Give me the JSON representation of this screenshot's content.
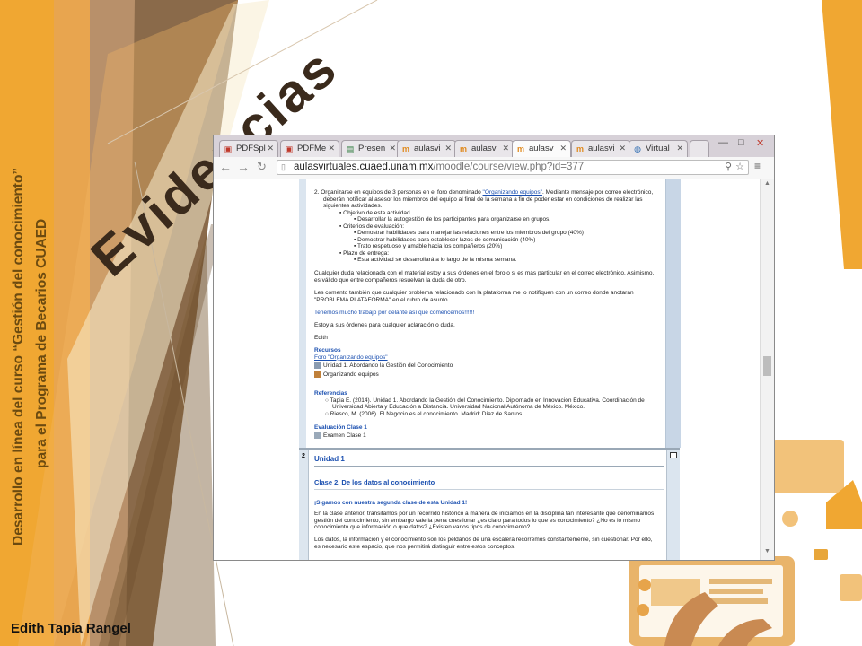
{
  "slide": {
    "title": "Evidencias",
    "vertical_line1": "Desarrollo en línea del curso “Gestión del conocimiento”",
    "vertical_line2": "para el Programa de Becarios CUAED",
    "author": "Edith Tapia Rangel"
  },
  "browser": {
    "tabs": [
      {
        "label": "PDFSpl",
        "active": false
      },
      {
        "label": "PDFMe",
        "active": false
      },
      {
        "label": "Presen",
        "active": false
      },
      {
        "label": "aulasvi",
        "active": false
      },
      {
        "label": "aulasvi",
        "active": false
      },
      {
        "label": "aulasv",
        "active": true
      },
      {
        "label": "aulasvi",
        "active": false
      },
      {
        "label": "Virtual",
        "active": false
      }
    ],
    "url_host": "aulasvirtuales.cuaed.unam.mx",
    "url_path": "/moodle/course/view.php?id=377"
  },
  "content": {
    "item2_a": "2.   Organizarse en equipos de 3 personas en el foro denominado ",
    "item2_link": "\"Organizando equipos\"",
    "item2_b": ". Mediante mensaje por correo electrónico,",
    "item2_c": "deberán notificar al asesor los miembros del equipo al final de la semana a fin de poder estar en condiciones de realizar las",
    "item2_d": "siguientes actividades.",
    "obj_head": "Objetivo de esta actividad",
    "obj_1": "Desarrollar la autogestión de los participantes para organizarse en grupos.",
    "crit_head": "Criterios de evaluación:",
    "crit_1": "Demostrar habilidades para manejar las relaciones entre los miembros del grupo (40%)",
    "crit_2": "Demostrar habilidades para establecer lazos de comunicación (40%)",
    "crit_3": "Trato respetuoso y amable hacia los compañeros (20%)",
    "plazo_head": "Plazo de entrega:",
    "plazo_1": "Esta actividad se desarrollará a lo largo de la misma semana.",
    "p1a": "Cualquier duda relacionada con el material estoy a sus órdenes en el foro o si es más particular en el correo electrónico. Asimismo,",
    "p1b": "es válido que entre compañeros resuelvan la duda de otro.",
    "p2a": "Les comento también que cualquier problema relacionado con la plataforma me lo notifiquen con un correo donde anotarán",
    "p2b": "\"PROBLEMA PLATAFORMA\" en el rubro de asunto.",
    "p3": "Tenemos mucho trabajo por delante así que comencemos!!!!!!",
    "p4": "Estoy a sus órdenes para cualquier aclaración o duda.",
    "p5": "Edith",
    "recursos_head": "Recursos",
    "recursos_link": "Foro \"Organizando equipos\"",
    "recurso_1": "Unidad 1. Abordando la Gestión del Conocimiento",
    "recurso_2": "Organizando equipos",
    "ref_head": "Referencias",
    "ref_1a": "Tapia E. (2014). Unidad 1. Abordando la Gestión del Conocimiento. Diplomado en Innovación Educativa. Coordinación de",
    "ref_1b": "Universidad Abierta y Educación a Distancia. Universidad Nacional Autónoma de México. México.",
    "ref_2": "Riesco, M. (2006). El Negocio es el conocimiento. Madrid: Díaz de Santos.",
    "eval_head": "Evaluación Clase 1",
    "eval_1": "Examen Clase 1",
    "sec2_num": "2",
    "unidad": "Unidad 1",
    "clase2": "Clase 2. De los datos al conocimiento",
    "sigamos": "¡Sigamos con nuestra segunda clase de esta Unidad 1!",
    "s2p1a": "En la clase anterior, transitamos por un recorrido histórico a manera de iniciarnos en la disciplina tan interesante que denominamos",
    "s2p1b": "gestión del conocimiento, sin embargo vale la pena cuestionar ¿es claro para todos lo que es conocimiento? ¿No es lo mismo",
    "s2p1c": "conocimiento que información o que datos? ¿Existen varios tipos de conocimiento?",
    "s2p2a": "Los datos, la información y el conocimiento son los peldaños de una escalera recorremos constantemente, sin cuestionar. Por ello,",
    "s2p2b": "es necesario este espacio, que nos permitirá distinguir entre estos conceptos."
  },
  "colors": {
    "orange": "#f0a732",
    "tan": "#c9935a",
    "brown": "#7a5a36",
    "cream": "#f7eccf",
    "link_blue": "#1a4fb0"
  },
  "icons": [
    "close-icon",
    "back-arrow-icon",
    "forward-arrow-icon",
    "reload-icon",
    "page-icon",
    "zoom-icon",
    "star-icon",
    "menu-icon",
    "minimize-icon",
    "maximize-icon",
    "forum-icon",
    "document-icon",
    "quiz-icon"
  ]
}
